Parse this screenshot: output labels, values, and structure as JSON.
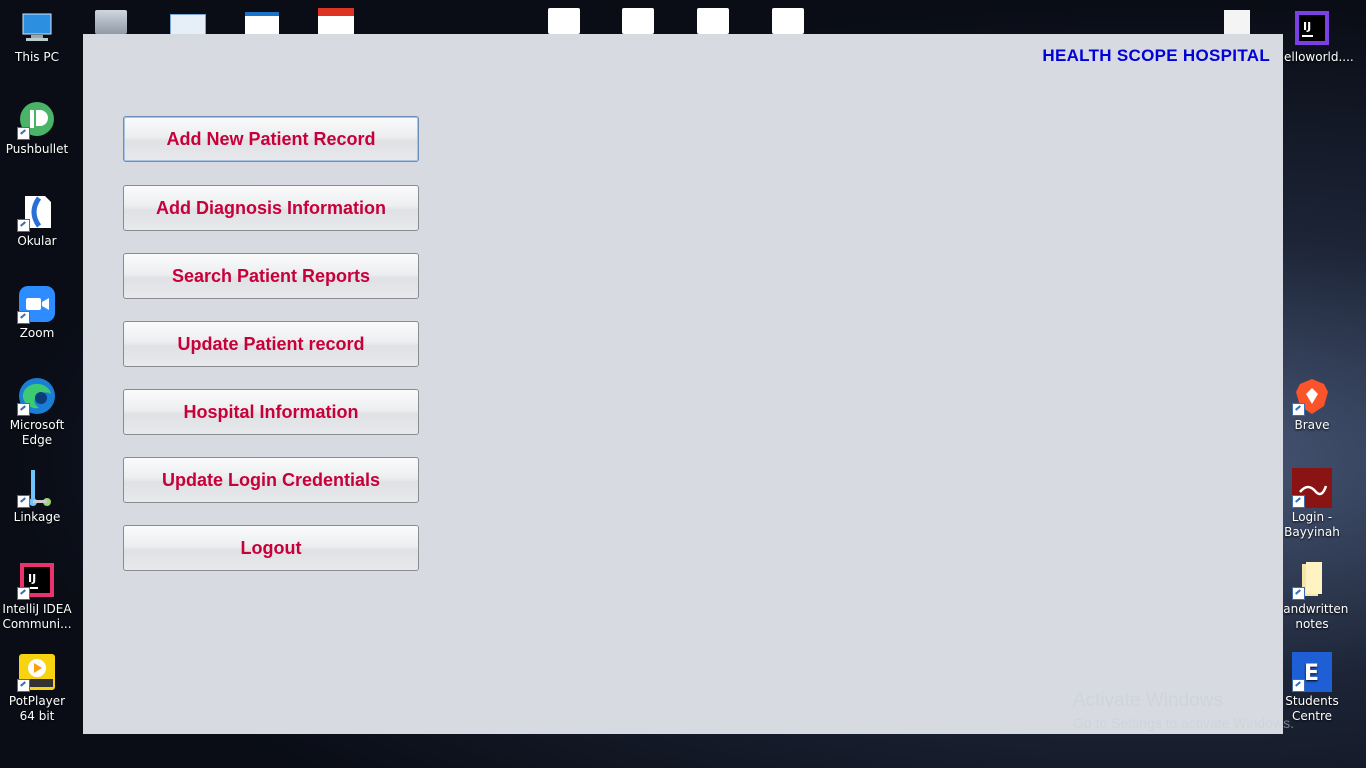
{
  "desktop": {
    "left_icons": [
      {
        "label": "This PC",
        "icon": "computer-icon"
      },
      {
        "label": "Pushbullet",
        "icon": "pushbullet-icon"
      },
      {
        "label": "Okular",
        "icon": "okular-icon"
      },
      {
        "label": "Zoom",
        "icon": "zoom-icon"
      },
      {
        "label": "Microsoft Edge",
        "icon": "edge-icon"
      },
      {
        "label": "Linkage",
        "icon": "linkage-icon"
      },
      {
        "label": "IntelliJ IDEA Communi...",
        "icon": "intellij-icon"
      },
      {
        "label": "PotPlayer 64 bit",
        "icon": "potplayer-icon"
      }
    ],
    "right_icons": [
      {
        "label": "Helloworld....",
        "icon": "intellij-icon"
      },
      {
        "label": "Brave",
        "icon": "brave-icon"
      },
      {
        "label": "Login - Bayyinah",
        "icon": "bayyinah-icon"
      },
      {
        "label": "handwritten notes",
        "icon": "folder-icon"
      },
      {
        "label": "Students Centre",
        "icon": "students-centre-icon"
      }
    ],
    "colors": {
      "accent_blue": "#0000d8",
      "button_text": "#c8003a",
      "window_bg": "#d7dae1"
    }
  },
  "app": {
    "title": "HEALTH SCOPE HOSPITAL",
    "buttons": [
      {
        "label": "Add New Patient Record"
      },
      {
        "label": "Add Diagnosis Information"
      },
      {
        "label": "Search Patient Reports"
      },
      {
        "label": "Update Patient record"
      },
      {
        "label": "Hospital Information"
      },
      {
        "label": "Update Login Credentials"
      },
      {
        "label": "Logout"
      }
    ]
  },
  "watermark": {
    "title": "Activate Windows",
    "subtitle": "Go to Settings to activate Windows."
  }
}
